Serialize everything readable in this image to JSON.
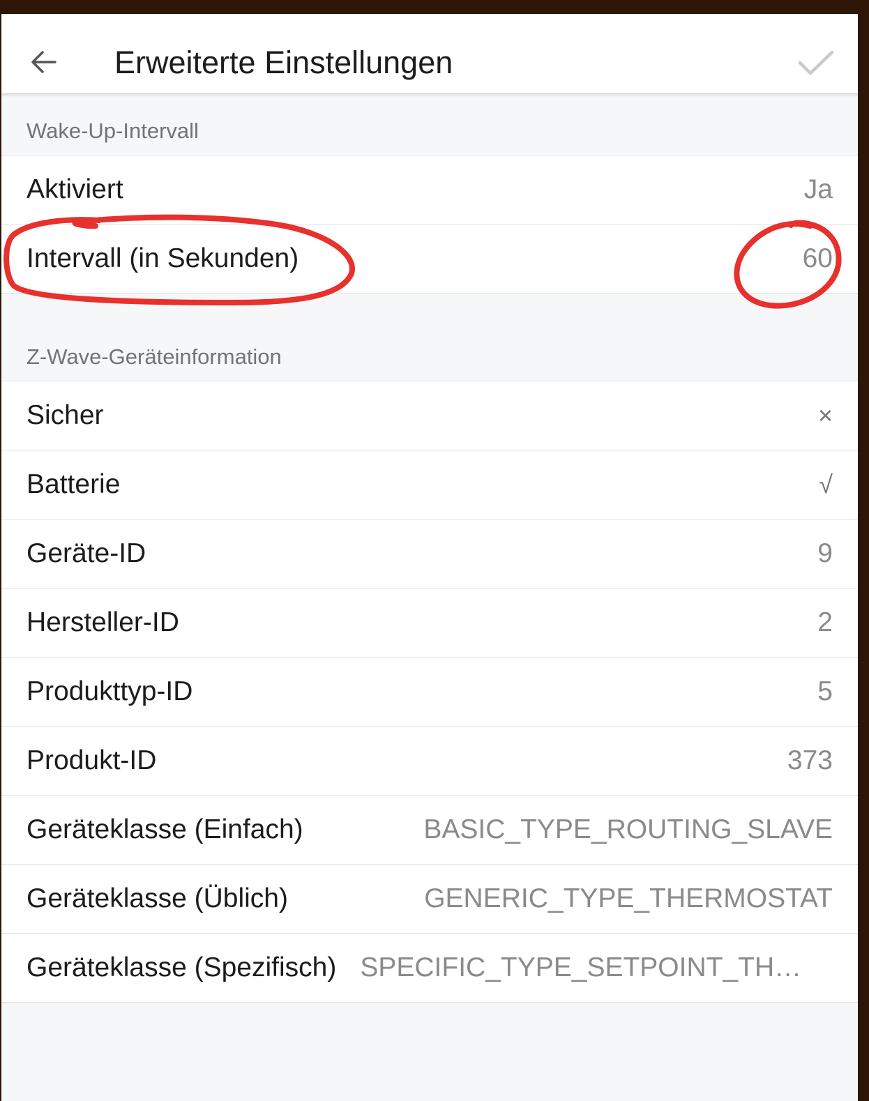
{
  "header": {
    "title": "Erweiterte Einstellungen",
    "back_icon": "arrow-left-icon",
    "confirm_icon": "checkmark-icon"
  },
  "sections": {
    "wakeup": {
      "title": "Wake-Up-Intervall",
      "rows": [
        {
          "label": "Aktiviert",
          "value": "Ja"
        },
        {
          "label": "Intervall (in Sekunden)",
          "value": "60"
        }
      ]
    },
    "zwave": {
      "title": "Z-Wave-Geräteinformation",
      "rows": [
        {
          "label": "Sicher",
          "value": "×"
        },
        {
          "label": "Batterie",
          "value": "√"
        },
        {
          "label": "Geräte-ID",
          "value": "9"
        },
        {
          "label": "Hersteller-ID",
          "value": "2"
        },
        {
          "label": "Produkttyp-ID",
          "value": "5"
        },
        {
          "label": "Produkt-ID",
          "value": "373"
        },
        {
          "label": "Geräteklasse (Einfach)",
          "value": "BASIC_TYPE_ROUTING_SLAVE"
        },
        {
          "label": "Geräteklasse (Üblich)",
          "value": "GENERIC_TYPE_THERMOSTAT"
        },
        {
          "label": "Geräteklasse (Spezifisch)",
          "value": "SPECIFIC_TYPE_SETPOINT_THERMOSTAT"
        }
      ]
    }
  },
  "colors": {
    "annotation": "#e8302c",
    "outer_background": "#2e1606",
    "screen_background": "#f6f7f9"
  }
}
